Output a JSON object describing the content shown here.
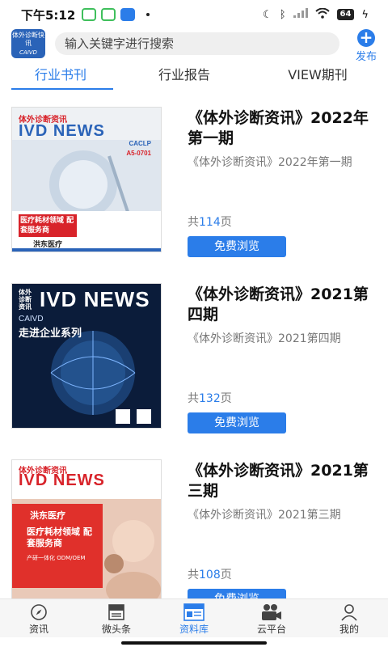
{
  "status_bar": {
    "time": "下午5:12",
    "battery": "64"
  },
  "header": {
    "logo_text": "体外诊断快讯",
    "logo_sub": "CAIVD",
    "search_placeholder": "输入关键字进行搜索",
    "publish_label": "发布"
  },
  "tabs": [
    {
      "label": "行业书刊",
      "active": true
    },
    {
      "label": "行业报告",
      "active": false
    },
    {
      "label": "VIEW期刊",
      "active": false
    }
  ],
  "books": [
    {
      "title": "《体外诊断资讯》2022年第一期",
      "subtitle": "《体外诊断资讯》2022年第一期",
      "pages_prefix": "共",
      "pages": "114",
      "pages_suffix": "页",
      "button": "免费浏览",
      "cover": {
        "brand": "体外诊断资讯",
        "masthead": "IVD NEWS",
        "badge": "CACLP",
        "issue": "A5-0701",
        "banner": "医疗耗材领域 配套服务商",
        "company": "洪东医疗"
      }
    },
    {
      "title": "《体外诊断资讯》2021第四期",
      "subtitle": "《体外诊断资讯》2021第四期",
      "pages_prefix": "共",
      "pages": "132",
      "pages_suffix": "页",
      "button": "免费浏览",
      "cover": {
        "brand": "体外诊断资讯",
        "masthead": "IVD NEWS",
        "org": "CAIVD",
        "series": "走进企业系列"
      }
    },
    {
      "title": "《体外诊断资讯》2021第三期",
      "subtitle": "《体外诊断资讯》2021第三期",
      "pages_prefix": "共",
      "pages": "108",
      "pages_suffix": "页",
      "button": "免费浏览",
      "cover": {
        "brand": "体外诊断资讯",
        "masthead": "IVD NEWS",
        "company": "洪东医疗",
        "banner": "医疗耗材领域 配套服务商",
        "sub": "产研一体化 ODM/OEM"
      }
    }
  ],
  "bottom_nav": [
    {
      "label": "资讯",
      "icon": "compass-icon",
      "active": false
    },
    {
      "label": "微头条",
      "icon": "headline-icon",
      "active": false
    },
    {
      "label": "资料库",
      "icon": "news-icon",
      "active": true
    },
    {
      "label": "云平台",
      "icon": "camera-icon",
      "active": false
    },
    {
      "label": "我的",
      "icon": "user-icon",
      "active": false
    }
  ],
  "colors": {
    "accent": "#2b7de9",
    "muted_text": "#777777"
  }
}
